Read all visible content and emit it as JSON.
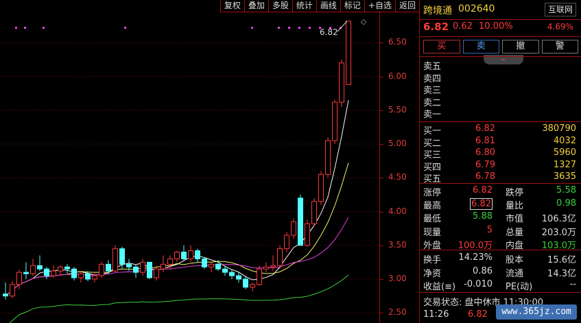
{
  "toolbar": [
    "复权",
    "叠加",
    "多股",
    "统计",
    "画线",
    "标记",
    "+自选",
    "返回"
  ],
  "chart_annotation": {
    "label": "6.82",
    "marker": "◇"
  },
  "y_ticks": [
    "6.50",
    "6.00",
    "5.50",
    "5.00",
    "4.50",
    "4.00",
    "3.50",
    "3.00",
    "2.50"
  ],
  "header": {
    "name": "跨境通",
    "code": "002640",
    "tag": "互联网"
  },
  "quote": {
    "price": "6.82",
    "change": "0.62",
    "change_pct": "10.00%",
    "turnover_pct": "4.69%"
  },
  "trade_buttons": [
    "买",
    "卖",
    "撤",
    "警"
  ],
  "expand_icon": "chevron-down-icon",
  "asks": [
    {
      "label": "卖五",
      "price": "",
      "vol": ""
    },
    {
      "label": "卖四",
      "price": "",
      "vol": ""
    },
    {
      "label": "卖三",
      "price": "",
      "vol": ""
    },
    {
      "label": "卖二",
      "price": "",
      "vol": ""
    },
    {
      "label": "卖一",
      "price": "",
      "vol": ""
    }
  ],
  "bids": [
    {
      "label": "买一",
      "price": "6.82",
      "vol": "380790"
    },
    {
      "label": "买二",
      "price": "6.81",
      "vol": "4032"
    },
    {
      "label": "买三",
      "price": "6.80",
      "vol": "5960"
    },
    {
      "label": "买四",
      "price": "6.79",
      "vol": "1327"
    },
    {
      "label": "买五",
      "price": "6.78",
      "vol": "3635"
    }
  ],
  "stats1": [
    {
      "l1": "涨停",
      "v1": "6.82",
      "c1": "red",
      "l2": "跌停",
      "v2": "5.58",
      "c2": "green"
    },
    {
      "l1": "最高",
      "v1": "6.82",
      "c1": "red",
      "l2": "量比",
      "v2": "0.98",
      "c2": "green"
    },
    {
      "l1": "最低",
      "v1": "5.88",
      "c1": "green",
      "l2": "市值",
      "v2": "106.3亿",
      "c2": "white"
    },
    {
      "l1": "现量",
      "v1": "5",
      "c1": "red",
      "l2": "总量",
      "v2": "203.0万",
      "c2": "white"
    },
    {
      "l1": "外盘",
      "v1": "100.0万",
      "c1": "red",
      "l2": "内盘",
      "v2": "103.0万",
      "c2": "green"
    }
  ],
  "stats2": [
    {
      "l1": "换手",
      "v1": "14.23%",
      "c1": "white",
      "l2": "股本",
      "v2": "15.6亿",
      "c2": "white"
    },
    {
      "l1": "净资",
      "v1": "0.86",
      "c1": "white",
      "l2": "流通",
      "v2": "14.3亿",
      "c2": "white"
    },
    {
      "l1": "收益(≡)",
      "v1": "-0.010",
      "c1": "white",
      "l2": "PE(动)",
      "v2": "--",
      "c2": "white"
    }
  ],
  "status": "交易状态: 盘中休市 11:30:00",
  "last_tick": {
    "time": "11:26",
    "price": "6.82"
  },
  "watermark": "www.365jz.com",
  "colors": {
    "up": "#ff3a3a",
    "down": "#3ad23a",
    "down_candle": "#54ffff",
    "border": "#a01010",
    "ma5": "#ffffff",
    "ma10": "#f3f36a",
    "ma20": "#e040e0",
    "ma60": "#3ad23a"
  },
  "chart_data": {
    "type": "candlestick",
    "title": "",
    "ylim": [
      2.35,
      6.95
    ],
    "y_ticks": [
      6.5,
      6.0,
      5.5,
      5.0,
      4.5,
      4.0,
      3.5,
      3.0,
      2.5
    ],
    "candles": [
      [
        2.78,
        2.95,
        2.7,
        2.75
      ],
      [
        2.75,
        2.97,
        2.72,
        2.92
      ],
      [
        2.92,
        3.14,
        2.85,
        3.1
      ],
      [
        3.1,
        3.25,
        3.0,
        3.08
      ],
      [
        3.08,
        3.3,
        3.05,
        3.2
      ],
      [
        3.2,
        3.35,
        3.12,
        3.15
      ],
      [
        3.15,
        3.18,
        3.0,
        3.05
      ],
      [
        3.05,
        3.2,
        3.02,
        3.12
      ],
      [
        3.12,
        3.2,
        3.05,
        3.18
      ],
      [
        3.18,
        3.22,
        3.08,
        3.15
      ],
      [
        3.15,
        3.18,
        2.98,
        3.02
      ],
      [
        3.02,
        3.12,
        2.95,
        3.08
      ],
      [
        3.08,
        3.12,
        2.97,
        3.0
      ],
      [
        3.0,
        3.1,
        2.95,
        3.05
      ],
      [
        3.05,
        3.25,
        3.02,
        3.22
      ],
      [
        3.22,
        3.28,
        3.08,
        3.12
      ],
      [
        3.12,
        3.5,
        3.1,
        3.45
      ],
      [
        3.45,
        3.48,
        3.15,
        3.22
      ],
      [
        3.22,
        3.3,
        3.12,
        3.18
      ],
      [
        3.18,
        3.22,
        3.02,
        3.1
      ],
      [
        3.1,
        3.3,
        3.05,
        3.25
      ],
      [
        3.25,
        3.22,
        3.0,
        3.02
      ],
      [
        3.02,
        3.2,
        2.98,
        3.15
      ],
      [
        3.15,
        3.35,
        3.1,
        3.22
      ],
      [
        3.22,
        3.35,
        3.15,
        3.3
      ],
      [
        3.3,
        3.42,
        3.25,
        3.4
      ],
      [
        3.4,
        3.5,
        3.28,
        3.3
      ],
      [
        3.3,
        3.5,
        3.25,
        3.42
      ],
      [
        3.42,
        3.45,
        3.25,
        3.3
      ],
      [
        3.3,
        3.32,
        3.15,
        3.18
      ],
      [
        3.18,
        3.25,
        3.1,
        3.22
      ],
      [
        3.22,
        3.28,
        3.12,
        3.15
      ],
      [
        3.15,
        3.2,
        3.05,
        3.1
      ],
      [
        3.1,
        3.15,
        3.0,
        3.05
      ],
      [
        3.05,
        3.1,
        2.95,
        3.0
      ],
      [
        3.0,
        3.05,
        2.85,
        2.88
      ],
      [
        2.88,
        2.95,
        2.82,
        2.92
      ],
      [
        2.92,
        3.2,
        2.9,
        3.15
      ],
      [
        3.15,
        3.25,
        3.1,
        3.18
      ],
      [
        3.18,
        3.35,
        3.12,
        3.2
      ],
      [
        3.2,
        3.5,
        3.15,
        3.45
      ],
      [
        3.45,
        3.7,
        3.4,
        3.65
      ],
      [
        3.65,
        3.9,
        3.6,
        3.85
      ],
      [
        4.2,
        4.25,
        3.5,
        3.5
      ],
      [
        3.5,
        3.88,
        3.48,
        3.82
      ],
      [
        3.82,
        4.2,
        3.78,
        4.15
      ],
      [
        4.15,
        4.6,
        4.1,
        4.55
      ],
      [
        4.55,
        5.1,
        4.5,
        5.05
      ],
      [
        5.05,
        5.65,
        5.0,
        5.62
      ],
      [
        5.62,
        6.25,
        5.55,
        6.2
      ],
      [
        5.88,
        6.82,
        5.88,
        6.82
      ]
    ],
    "annotation_high": 6.82
  }
}
